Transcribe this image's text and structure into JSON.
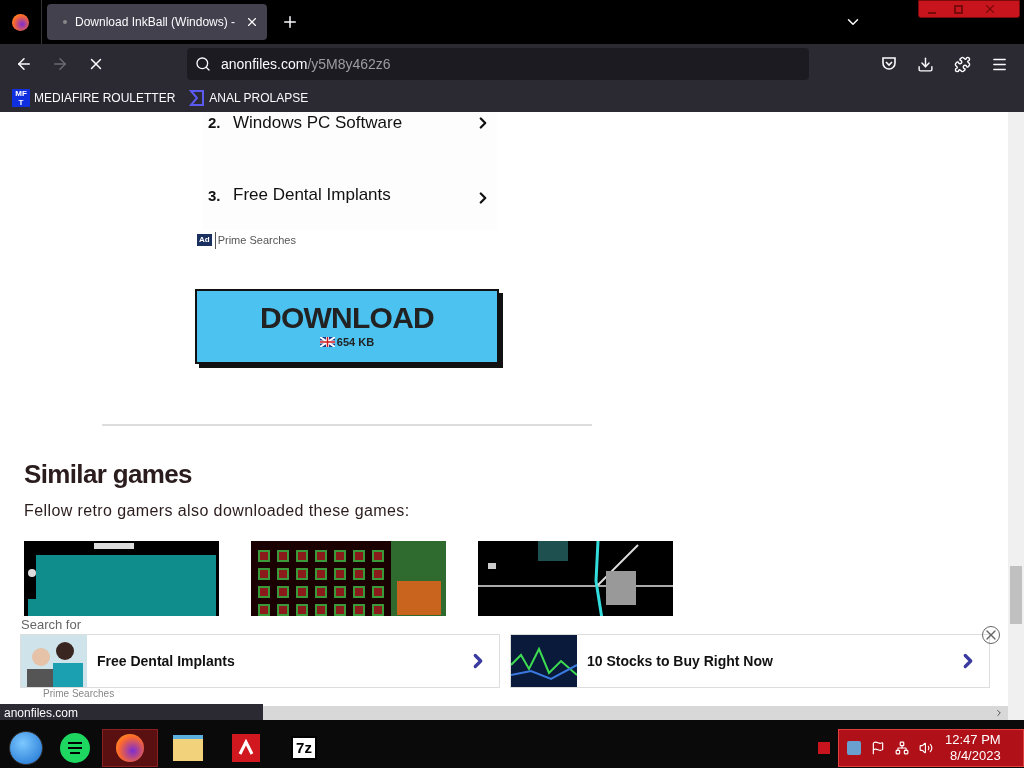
{
  "tabs": [
    {
      "label": "Download InkBall (Windows) - ",
      "selected": true
    }
  ],
  "address": {
    "host": "anonfiles.com",
    "path": "/y5M8y462z6"
  },
  "bookmarks": [
    {
      "label": "MEDIAFIRE ROULETTER",
      "badge": "MF T"
    },
    {
      "label": "ANAL PROLAPSE"
    }
  ],
  "search_list": [
    {
      "number": "2.",
      "label": "Windows PC Software"
    },
    {
      "number": "3.",
      "label": "Free Dental Implants"
    }
  ],
  "ad_label": {
    "badge": "Ad",
    "source": "Prime Searches"
  },
  "download": {
    "label": "DOWNLOAD",
    "size": "654 KB"
  },
  "similar": {
    "heading": "Similar games",
    "subtitle": "Fellow retro gamers also downloaded these games:"
  },
  "ad_bar": {
    "caption": "Search for",
    "items": [
      {
        "label": "Free Dental Implants"
      },
      {
        "label": "10 Stocks to Buy Right Now"
      }
    ],
    "footer": "Prime Searches"
  },
  "status_url": "anonfiles.com",
  "taskbar": {
    "time": "12:47 PM",
    "date": "8/4/2023",
    "apps": [
      {
        "kind": "start"
      },
      {
        "kind": "notes"
      },
      {
        "kind": "browser",
        "selected": true
      },
      {
        "kind": "files",
        "selected": false
      },
      {
        "kind": "antivirus",
        "selected": false
      },
      {
        "kind": "archive",
        "label": "7z",
        "selected": false
      }
    ]
  }
}
